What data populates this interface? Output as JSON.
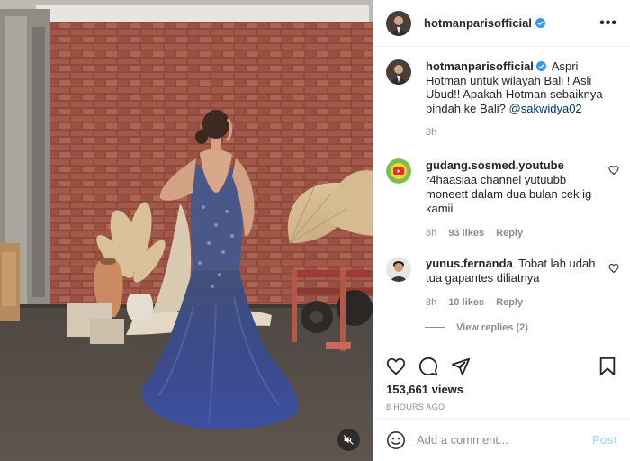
{
  "post": {
    "username": "hotmanparisofficial",
    "caption": "Aspri Hotman untuk wilayah Bali ! Asli Ubud!! Apakah Hotman sebaiknya pindah ke Bali?",
    "mention": "@sakwidya02",
    "time": "8h",
    "views": "153,661 views",
    "date": "8 HOURS AGO"
  },
  "comments": [
    {
      "username": "gudang.sosmed.youtube",
      "text": "r4haasiaa channel yutuubb moneett dalam dua bulan cek ig kamii",
      "time": "8h",
      "likes": "93 likes",
      "reply": "Reply"
    },
    {
      "username": "yunus.fernanda",
      "text": "Tobat lah udah tua gapantes diliatnya",
      "time": "8h",
      "likes": "10 likes",
      "reply": "Reply",
      "view_replies": "View replies (2)"
    }
  ],
  "add_comment": {
    "placeholder": "Add a comment...",
    "post_label": "Post"
  },
  "icons": {
    "more": "more-options-icon",
    "verified": "verified-badge-icon",
    "like": "heart-icon",
    "comment": "comment-icon",
    "share": "share-icon",
    "save": "bookmark-icon",
    "emoji": "emoji-icon",
    "mute": "muted-speaker-icon"
  },
  "colors": {
    "verified": "#3897f0",
    "mention": "#00376b",
    "muted_text": "#8e8e8e",
    "post_disabled": "#b2dffc"
  },
  "more_symbol": "•••"
}
